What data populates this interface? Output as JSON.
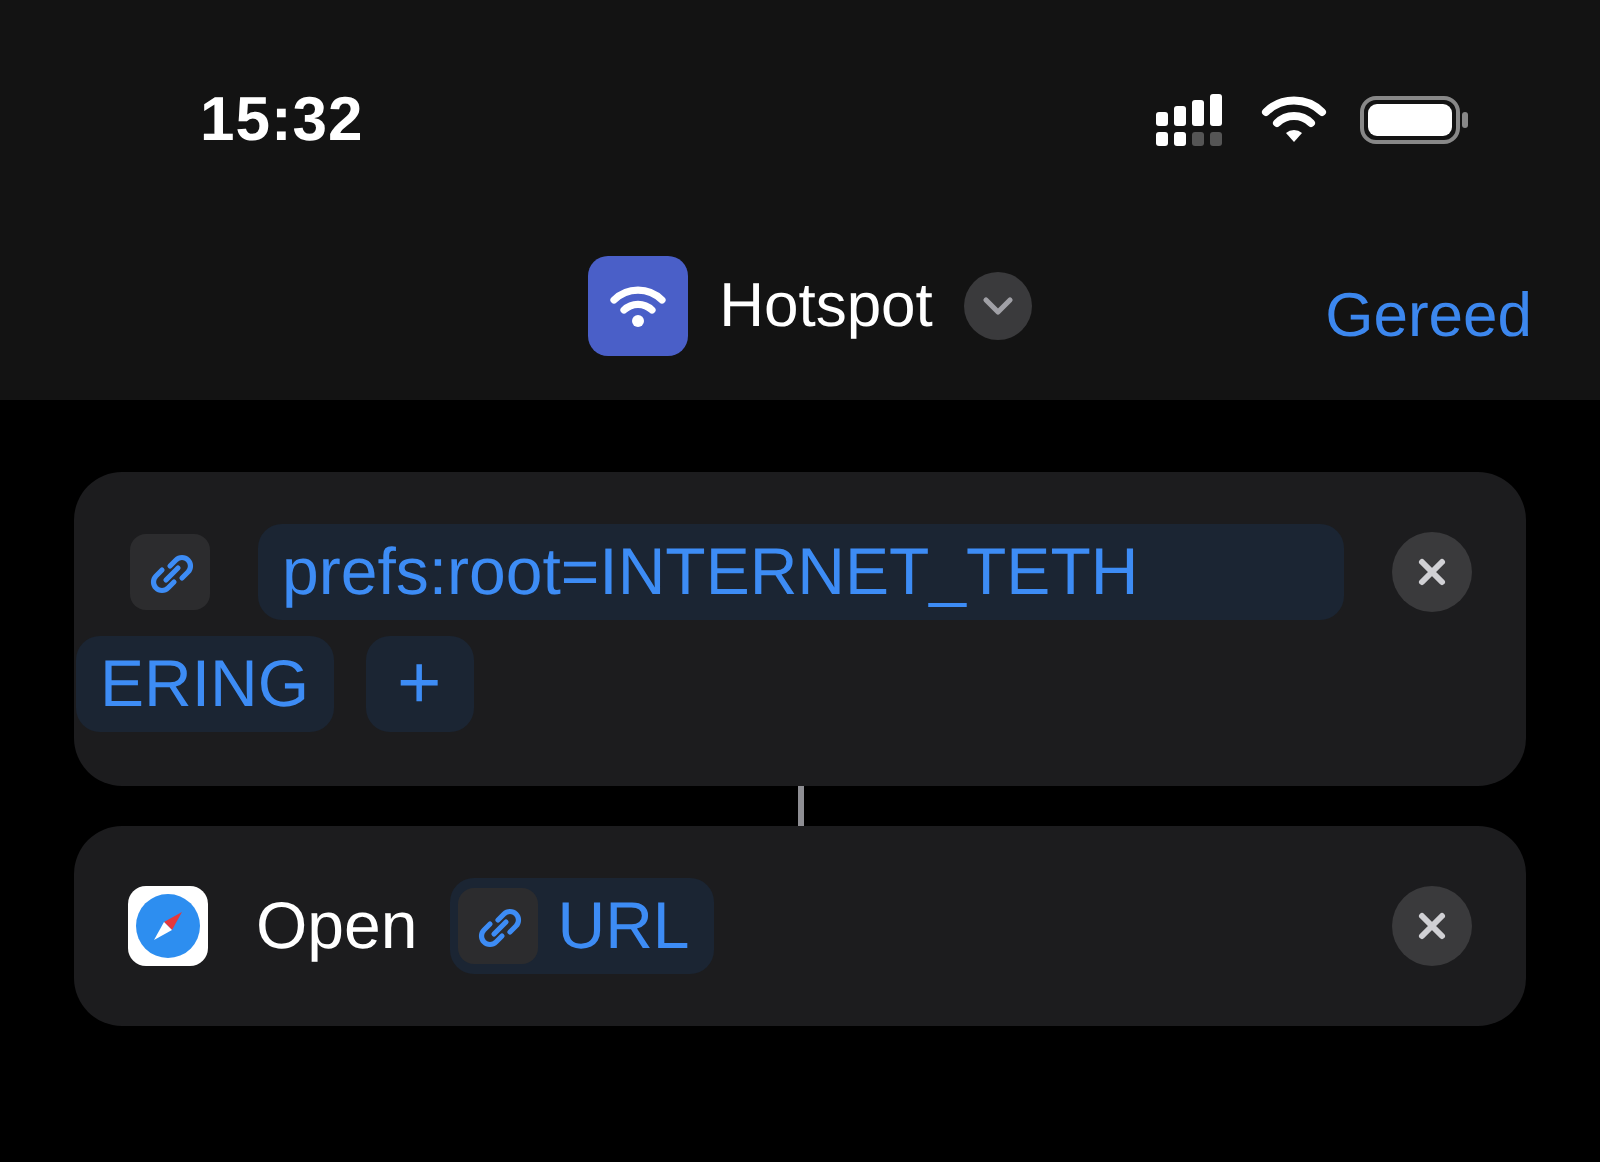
{
  "status_bar": {
    "time": "15:32"
  },
  "header": {
    "title": "Hotspot",
    "done": "Gereed"
  },
  "actions": [
    {
      "kind": "url",
      "lines": [
        "prefs:root=INTERNET_TETH",
        "ERING"
      ],
      "add": "+"
    },
    {
      "kind": "open",
      "verb": "Open",
      "token": "URL"
    }
  ]
}
